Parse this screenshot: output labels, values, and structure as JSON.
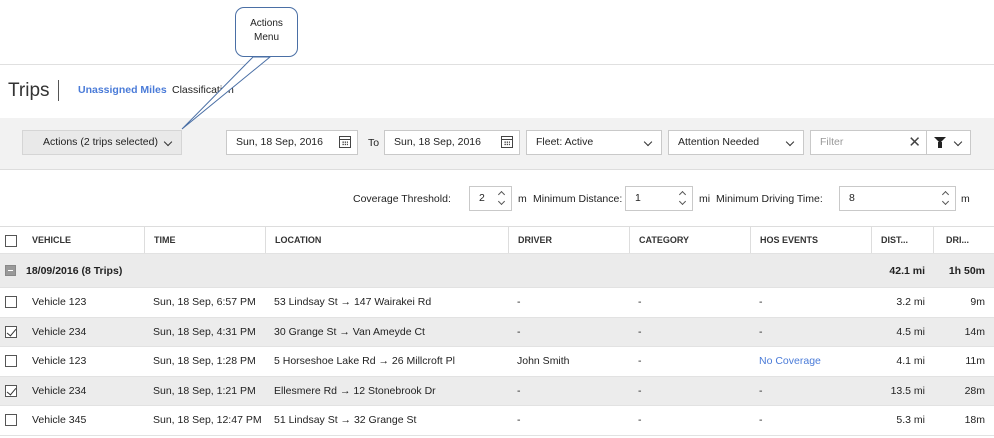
{
  "callout": {
    "line1": "Actions",
    "line2": "Menu"
  },
  "header": {
    "title": "Trips",
    "tabs": [
      "Unassigned Miles",
      "Classification"
    ]
  },
  "toolbar": {
    "actions_label": "Actions (2 trips selected)",
    "date_from": "Sun, 18 Sep, 2016",
    "to_label": "To",
    "date_to": "Sun, 18 Sep, 2016",
    "fleet": "Fleet: Active",
    "attention": "Attention Needed",
    "filter_placeholder": "Filter",
    "close_glyph": "✕"
  },
  "thresholds": {
    "coverage_label": "Coverage Threshold:",
    "coverage_value": "2",
    "coverage_unit": "m",
    "distance_label": "Minimum Distance:",
    "distance_value": "1",
    "distance_unit": "mi",
    "driving_label": "Minimum Driving Time:",
    "driving_value": "8",
    "driving_unit": "m"
  },
  "table": {
    "headers": [
      "VEHICLE",
      "TIME",
      "LOCATION",
      "DRIVER",
      "CATEGORY",
      "HOS EVENTS",
      "DIST...",
      "DRI..."
    ],
    "group": {
      "label": "18/09/2016 (8 Trips)",
      "distance": "42.1 mi",
      "duration": "1h 50m"
    },
    "rows": [
      {
        "vehicle": "Vehicle 123",
        "time": "Sun, 18 Sep, 6:57 PM",
        "location": "53 Lindsay St → 147 Wairakei Rd",
        "driver": "-",
        "category": "-",
        "hos": "-",
        "distance": "3.2 mi",
        "duration": "9m",
        "checked": false
      },
      {
        "vehicle": "Vehicle 234",
        "time": "Sun, 18 Sep, 4:31 PM",
        "location": "30 Grange St → Van Ameyde Ct",
        "driver": "-",
        "category": "-",
        "hos": "-",
        "distance": "4.5 mi",
        "duration": "14m",
        "checked": true
      },
      {
        "vehicle": "Vehicle 123",
        "time": "Sun, 18 Sep, 1:28 PM",
        "location": "5 Horseshoe Lake Rd → 26 Millcroft Pl",
        "driver": "John Smith",
        "category": "-",
        "hos": "No Coverage",
        "distance": "4.1 mi",
        "duration": "11m",
        "checked": false
      },
      {
        "vehicle": "Vehicle 234",
        "time": "Sun, 18 Sep, 1:21 PM",
        "location": "Ellesmere Rd → 12 Stonebrook Dr",
        "driver": "-",
        "category": "-",
        "hos": "-",
        "distance": "13.5 mi",
        "duration": "28m",
        "checked": true
      },
      {
        "vehicle": "Vehicle 345",
        "time": "Sun, 18 Sep, 12:47 PM",
        "location": "51 Lindsay St → 32 Grange St",
        "driver": "-",
        "category": "-",
        "hos": "-",
        "distance": "5.3 mi",
        "duration": "18m",
        "checked": false
      }
    ]
  }
}
